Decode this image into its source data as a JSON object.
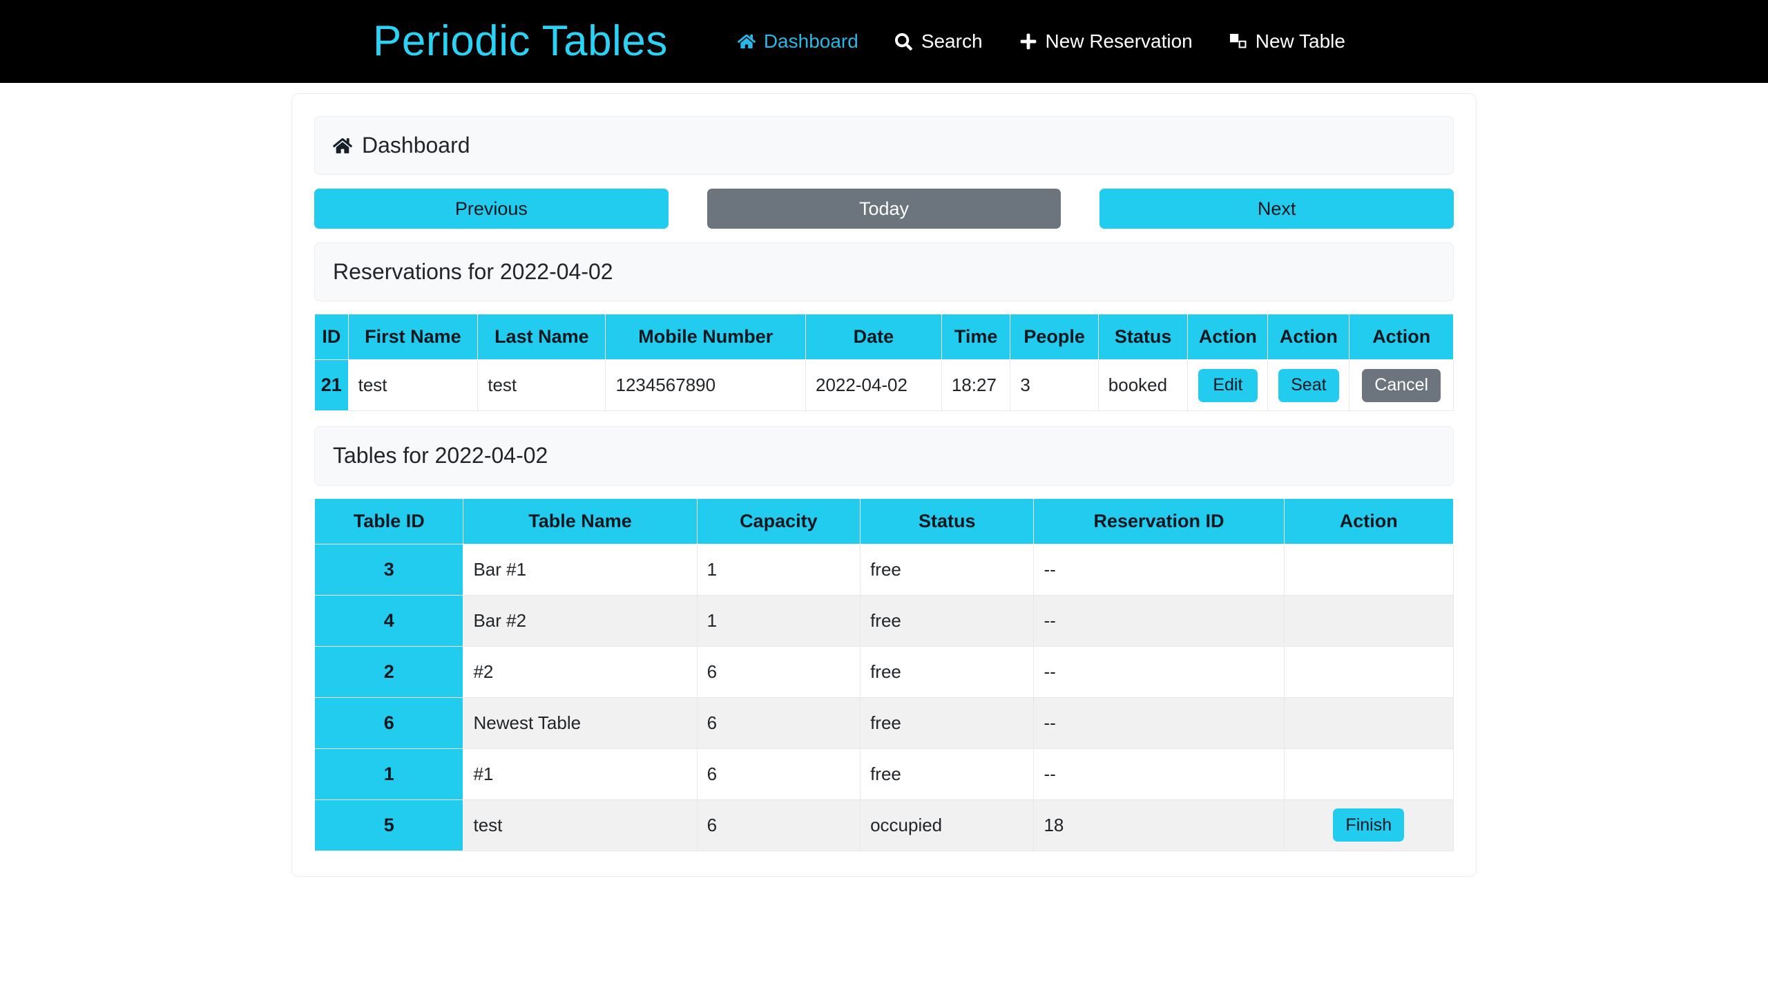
{
  "navbar": {
    "brand": "Periodic Tables",
    "links": [
      {
        "label": "Dashboard",
        "icon": "home-icon",
        "active": true
      },
      {
        "label": "Search",
        "icon": "search-icon",
        "active": false
      },
      {
        "label": "New Reservation",
        "icon": "plus-icon",
        "active": false
      },
      {
        "label": "New Table",
        "icon": "clone-icon",
        "active": false
      }
    ]
  },
  "dashboard": {
    "heading": "Dashboard",
    "heading_icon": "home-icon",
    "daynav": {
      "previous_label": "Previous",
      "today_label": "Today",
      "next_label": "Next"
    },
    "reservations": {
      "heading": "Reservations for 2022-04-02",
      "date": "2022-04-02",
      "columns": [
        "ID",
        "First Name",
        "Last Name",
        "Mobile Number",
        "Date",
        "Time",
        "People",
        "Status",
        "Action",
        "Action",
        "Action"
      ],
      "rows": [
        {
          "id": "21",
          "first_name": "test",
          "last_name": "test",
          "mobile_number": "1234567890",
          "date": "2022-04-02",
          "time": "18:27",
          "people": "3",
          "status": "booked",
          "edit_label": "Edit",
          "seat_label": "Seat",
          "cancel_label": "Cancel"
        }
      ]
    },
    "tables": {
      "heading": "Tables for 2022-04-02",
      "date": "2022-04-02",
      "columns": [
        "Table ID",
        "Table Name",
        "Capacity",
        "Status",
        "Reservation ID",
        "Action"
      ],
      "rows": [
        {
          "table_id": "3",
          "table_name": "Bar #1",
          "capacity": "1",
          "status": "free",
          "reservation_id": "--",
          "action_label": ""
        },
        {
          "table_id": "4",
          "table_name": "Bar #2",
          "capacity": "1",
          "status": "free",
          "reservation_id": "--",
          "action_label": ""
        },
        {
          "table_id": "2",
          "table_name": "#2",
          "capacity": "6",
          "status": "free",
          "reservation_id": "--",
          "action_label": ""
        },
        {
          "table_id": "6",
          "table_name": "Newest Table",
          "capacity": "6",
          "status": "free",
          "reservation_id": "--",
          "action_label": ""
        },
        {
          "table_id": "1",
          "table_name": "#1",
          "capacity": "6",
          "status": "free",
          "reservation_id": "--",
          "action_label": ""
        },
        {
          "table_id": "5",
          "table_name": "test",
          "capacity": "6",
          "status": "occupied",
          "reservation_id": "18",
          "action_label": "Finish"
        }
      ]
    }
  },
  "colors": {
    "accent_cyan": "#22ccee",
    "brand_cyan": "#2ad2f5",
    "secondary_gray": "#6c757d",
    "navbar_black": "#000000",
    "panel_bg": "#f8f9fb",
    "stripe_bg": "#f1f1f1"
  }
}
